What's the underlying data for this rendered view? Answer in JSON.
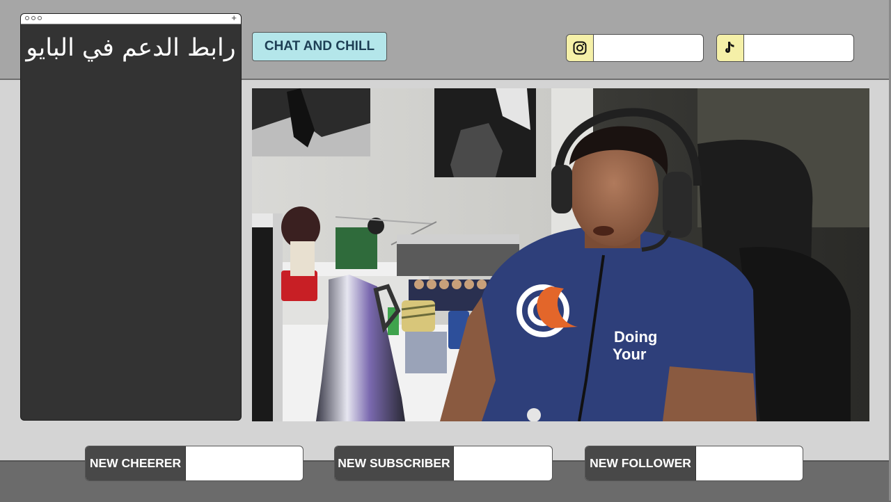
{
  "chat_panel": {
    "text": "رابط الدعم في البايو"
  },
  "badge": {
    "label": "CHAT AND CHILL"
  },
  "social": [
    {
      "icon": "instagram-icon",
      "value": ""
    },
    {
      "icon": "tiktok-icon",
      "value": ""
    }
  ],
  "alerts": [
    {
      "label": "NEW CHEERER",
      "value": ""
    },
    {
      "label": "NEW SUBSCRIBER",
      "value": ""
    },
    {
      "label": "NEW FOLLOWER",
      "value": ""
    }
  ],
  "webcam": {
    "shirt_text_line1": "Doing",
    "shirt_text_line2": "Your"
  },
  "colors": {
    "top_band": "#a6a6a6",
    "bottom_band": "#6b6b6b",
    "chat_bg": "#333333",
    "badge_bg": "#b4e6ea",
    "badge_text": "#1e3f55",
    "social_icon_bg": "#f5f0a8",
    "alert_label_bg": "#484848",
    "shirt": "#2e3f7a",
    "logo_accent": "#e3662a"
  }
}
